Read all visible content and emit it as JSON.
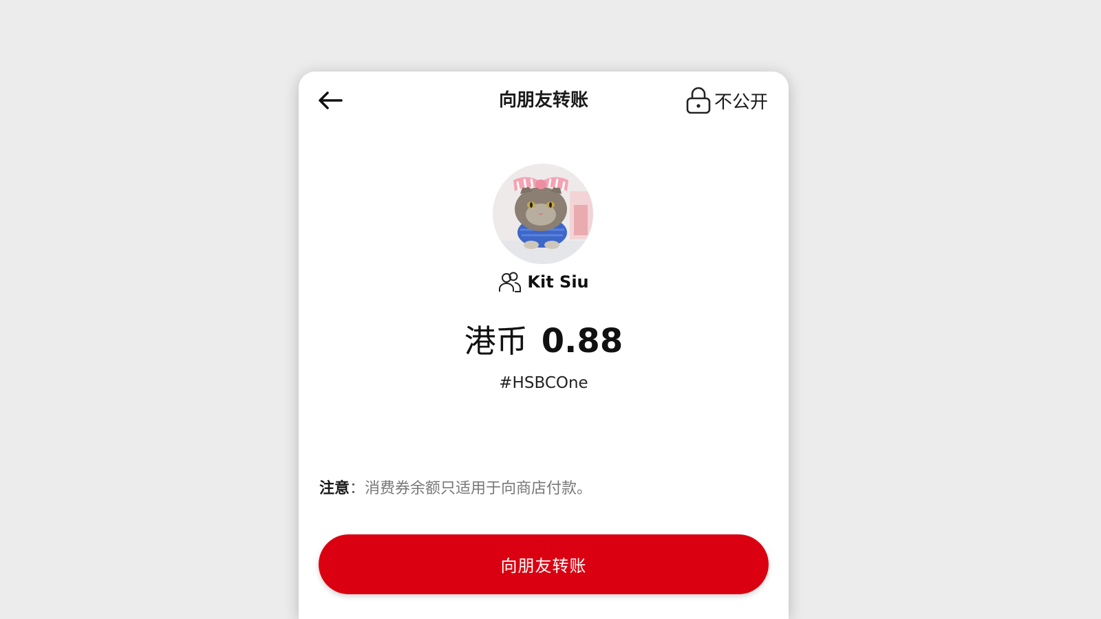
{
  "header": {
    "title": "向朋友转账",
    "privacy_label": "不公开"
  },
  "recipient": {
    "name": "Kit Siu"
  },
  "transfer": {
    "currency": "港币",
    "amount": "0.88",
    "tag": "#HSBCOne"
  },
  "note": {
    "label": "注意",
    "colon": "：",
    "text": "消费券余额只适用于向商店付款。"
  },
  "submit": {
    "label": "向朋友转账"
  },
  "colors": {
    "background": "#ececec",
    "card": "#ffffff",
    "accent_red": "#db0011"
  },
  "icons": {
    "back": "arrow-left-icon",
    "privacy": "lock-icon",
    "recipient": "people-icon"
  }
}
